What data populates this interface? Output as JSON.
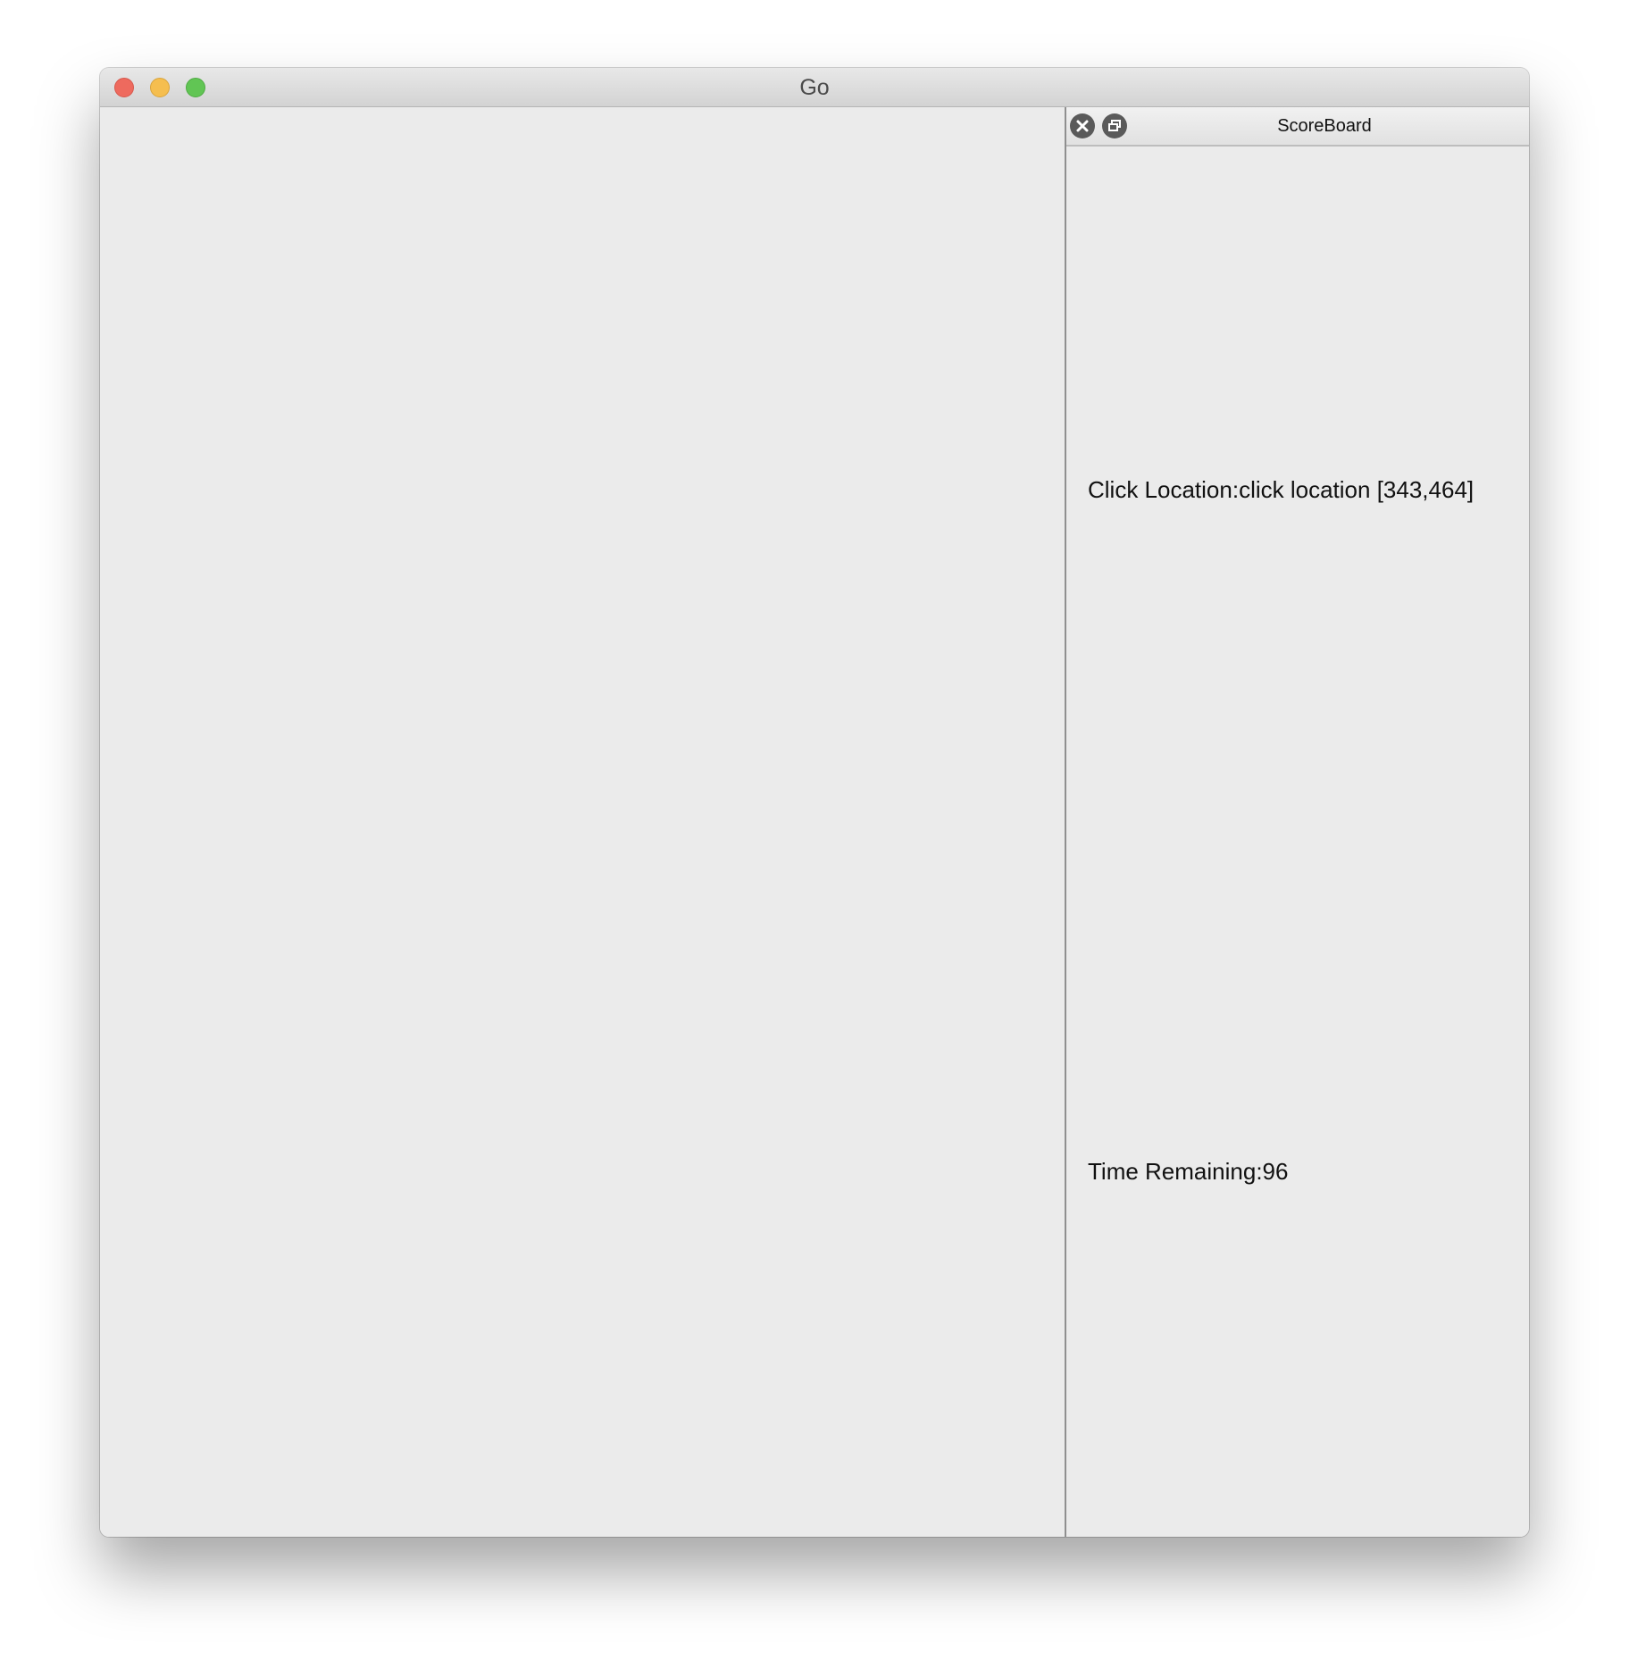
{
  "window": {
    "title": "Go"
  },
  "scoreboard": {
    "title": "ScoreBoard",
    "click_location_text": "Click Location:click location [343,464]",
    "time_remaining_text": "Time Remaining:96"
  },
  "icons": {
    "traffic_close": "close-window-icon",
    "traffic_minimize": "minimize-window-icon",
    "traffic_maximize": "maximize-window-icon",
    "dock_close": "close-icon",
    "dock_float": "float-icon"
  },
  "colors": {
    "traffic_close": "#ee6a5e",
    "traffic_minimize": "#f5be4f",
    "traffic_maximize": "#61c554",
    "window_background": "#ebebeb"
  }
}
